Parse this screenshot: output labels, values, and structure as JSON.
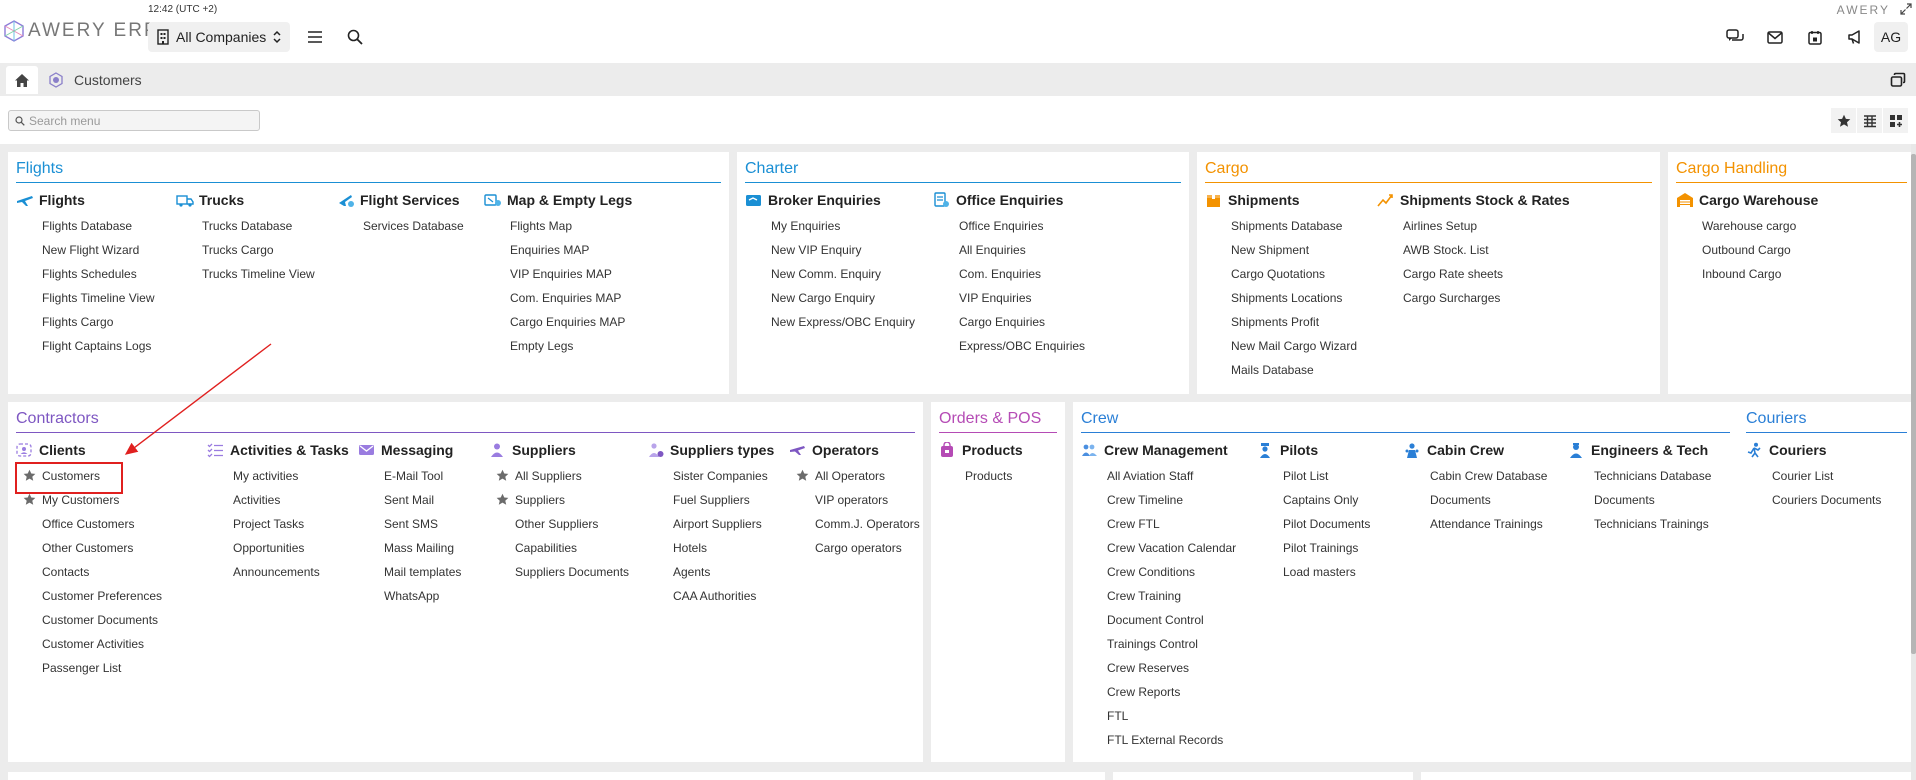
{
  "app": {
    "brand": "AWERY ERP",
    "brand_right": "AWERY",
    "clock": "12:42 (UTC +2)",
    "company_selector": "All Companies",
    "user_initials": "AG"
  },
  "tab": {
    "label": "Customers"
  },
  "search": {
    "placeholder": "Search menu"
  },
  "colors": {
    "flights": "#1a8fd4",
    "charter": "#1a8fd4",
    "cargo": "#f39200",
    "cargo_handling": "#f39200",
    "contractors": "#7e57c2",
    "orders": "#b54bb5",
    "crew": "#2a7fd6",
    "couriers": "#2a7fd6",
    "highlight": "#e0201f"
  },
  "panels": {
    "flights": {
      "title": "Flights",
      "columns": [
        {
          "head": "Flights",
          "icon": "plane-icon",
          "items": [
            "Flights Database",
            "New Flight Wizard",
            "Flights Schedules",
            "Flights Timeline View",
            "Flights Cargo",
            "Flight Captains Logs"
          ]
        },
        {
          "head": "Trucks",
          "icon": "truck-icon",
          "items": [
            "Trucks Database",
            "Trucks Cargo",
            "Trucks Timeline View"
          ]
        },
        {
          "head": "Flight Services",
          "icon": "flight-services-icon",
          "items": [
            "Services Database"
          ]
        },
        {
          "head": "Map & Empty Legs",
          "icon": "map-icon",
          "items": [
            "Flights Map",
            "Enquiries MAP",
            "VIP Enquiries MAP",
            "Com. Enquiries MAP",
            "Cargo Enquiries MAP",
            "Empty Legs"
          ]
        }
      ]
    },
    "charter": {
      "title": "Charter",
      "columns": [
        {
          "head": "Broker Enquiries",
          "icon": "broker-icon",
          "items": [
            "My Enquiries",
            "New VIP Enquiry",
            "New Comm. Enquiry",
            "New Cargo Enquiry",
            "New Express/OBC Enquiry"
          ]
        },
        {
          "head": "Office Enquiries",
          "icon": "office-enquiries-icon",
          "items": [
            "Office Enquiries",
            "All Enquiries",
            "Com. Enquiries",
            "VIP Enquiries",
            "Cargo Enquiries",
            "Express/OBC Enquiries"
          ]
        }
      ]
    },
    "cargo": {
      "title": "Cargo",
      "columns": [
        {
          "head": "Shipments",
          "icon": "box-icon",
          "items": [
            "Shipments Database",
            "New Shipment",
            "Cargo Quotations",
            "Shipments Locations",
            "Shipments Profit",
            "New Mail Cargo Wizard",
            "Mails Database"
          ]
        },
        {
          "head": "Shipments Stock & Rates",
          "icon": "chart-icon",
          "items": [
            "Airlines Setup",
            "AWB Stock. List",
            "Cargo Rate sheets",
            "Cargo Surcharges"
          ]
        }
      ]
    },
    "cargo_handling": {
      "title": "Cargo Handling",
      "columns": [
        {
          "head": "Cargo Warehouse",
          "icon": "warehouse-icon",
          "items": [
            "Warehouse cargo",
            "Outbound Cargo",
            "Inbound Cargo"
          ]
        }
      ]
    },
    "contractors": {
      "title": "Contractors",
      "columns": [
        {
          "head": "Clients",
          "icon": "clients-icon",
          "items": [
            "Customers",
            "My Customers",
            "Office Customers",
            "Other Customers",
            "Contacts",
            "Customer Preferences",
            "Customer Documents",
            "Customer Activities",
            "Passenger List"
          ],
          "starred": [
            0,
            1
          ]
        },
        {
          "head": "Activities & Tasks",
          "icon": "tasks-icon",
          "items": [
            "My activities",
            "Activities",
            "Project Tasks",
            "Opportunities",
            "Announcements"
          ]
        },
        {
          "head": "Messaging",
          "icon": "messaging-icon",
          "items": [
            "E-Mail Tool",
            "Sent Mail",
            "Sent SMS",
            "Mass Mailing",
            "Mail templates",
            "WhatsApp"
          ]
        },
        {
          "head": "Suppliers",
          "icon": "suppliers-icon",
          "items": [
            "All Suppliers",
            "Suppliers",
            "Other Suppliers",
            "Capabilities",
            "Suppliers Documents"
          ],
          "starred": [
            0,
            1
          ]
        },
        {
          "head": "Suppliers types",
          "icon": "supplier-types-icon",
          "items": [
            "Sister Companies",
            "Fuel Suppliers",
            "Airport Suppliers",
            "Hotels",
            "Agents",
            "CAA Authorities"
          ]
        },
        {
          "head": "Operators",
          "icon": "operators-icon",
          "items": [
            "All Operators",
            "VIP operators",
            "Comm.J. Operators",
            "Cargo operators"
          ],
          "starred": [
            0
          ]
        }
      ]
    },
    "orders": {
      "title": "Orders & POS",
      "columns": [
        {
          "head": "Products",
          "icon": "products-icon",
          "items": [
            "Products"
          ]
        }
      ]
    },
    "crew": {
      "title": "Crew",
      "columns": [
        {
          "head": "Crew Management",
          "icon": "crew-icon",
          "items": [
            "All Aviation Staff",
            "Crew Timeline",
            "Crew FTL",
            "Crew Vacation Calendar",
            "Crew Conditions",
            "Crew Training",
            "Document Control",
            "Trainings Control",
            "Crew Reserves",
            "Crew Reports",
            "FTL",
            "FTL External Records"
          ]
        },
        {
          "head": "Pilots",
          "icon": "pilot-icon",
          "items": [
            "Pilot List",
            "Captains Only",
            "Pilot Documents",
            "Pilot Trainings",
            "Load masters"
          ]
        },
        {
          "head": "Cabin Crew",
          "icon": "cabin-crew-icon",
          "items": [
            "Cabin Crew Database",
            "Documents",
            "Attendance Trainings"
          ]
        },
        {
          "head": "Engineers & Tech",
          "icon": "engineer-icon",
          "items": [
            "Technicians Database",
            "Documents",
            "Technicians Trainings"
          ]
        }
      ]
    },
    "couriers": {
      "title": "Couriers",
      "columns": [
        {
          "head": "Couriers",
          "icon": "courier-icon",
          "items": [
            "Courier List",
            "Couriers Documents"
          ]
        }
      ]
    }
  }
}
